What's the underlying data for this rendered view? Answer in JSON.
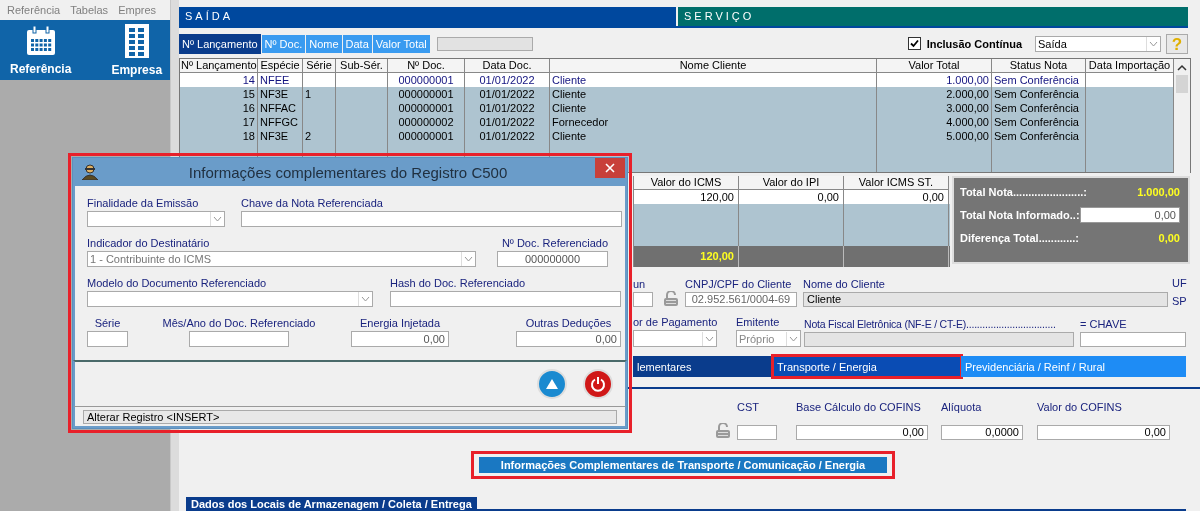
{
  "menu": [
    "Referência",
    "Tabelas",
    "Empres"
  ],
  "toolbar": [
    {
      "label": "Referência"
    },
    {
      "label": "Empresa"
    }
  ],
  "sections": [
    {
      "label": "SAÍDA",
      "color": "#00489e"
    },
    {
      "label": "SERVIÇO",
      "color": "#006e6b"
    }
  ],
  "sort_buttons": [
    {
      "label": "Nº Lançamento",
      "selected": true
    },
    {
      "label": "Nº Doc.",
      "selected": false
    },
    {
      "label": "Nome",
      "selected": false
    },
    {
      "label": "Data",
      "selected": false
    },
    {
      "label": "Valor Total",
      "selected": false
    }
  ],
  "continuous": {
    "label": "Inclusão Contínua",
    "checked": true
  },
  "type_select": {
    "value": "Saída"
  },
  "help": "?",
  "table": {
    "columns": [
      "Nº Lançamento",
      "Espécie",
      "Série",
      "Sub-Sér.",
      "Nº Doc.",
      "Data Doc.",
      "Nome Cliente",
      "Valor Total",
      "Status Nota",
      "Data Importação"
    ],
    "rows": [
      {
        "selected": true,
        "cells": [
          "14",
          "NFEE",
          "",
          "",
          "000000001",
          "01/01/2022",
          "Cliente",
          "1.000,00",
          "Sem Conferência",
          ""
        ]
      },
      {
        "selected": false,
        "cells": [
          "15",
          "NF3E",
          "1",
          "",
          "000000001",
          "01/01/2022",
          "Cliente",
          "2.000,00",
          "Sem Conferência",
          ""
        ]
      },
      {
        "selected": false,
        "cells": [
          "16",
          "NFFAC",
          "",
          "",
          "000000001",
          "01/01/2022",
          "Cliente",
          "3.000,00",
          "Sem Conferência",
          ""
        ]
      },
      {
        "selected": false,
        "cells": [
          "17",
          "NFFGC",
          "",
          "",
          "000000002",
          "01/01/2022",
          "Fornecedor",
          "4.000,00",
          "Sem Conferência",
          ""
        ]
      },
      {
        "selected": false,
        "cells": [
          "18",
          "NF3E",
          "2",
          "",
          "000000001",
          "01/01/2022",
          "Cliente",
          "5.000,00",
          "Sem Conferência",
          ""
        ]
      }
    ]
  },
  "items_table": {
    "columns": [
      "Valor do ICMS",
      "Valor do IPI",
      "Valor ICMS ST."
    ],
    "row": [
      "120,00",
      "0,00",
      "0,00"
    ],
    "total": "120,00"
  },
  "totals": [
    {
      "kind": "text",
      "label": "Total Nota.......................:",
      "value": "1.000,00"
    },
    {
      "kind": "input",
      "label": "Total Nota Informado..:",
      "value": "0,00"
    },
    {
      "kind": "text",
      "label": "Diferença Total............:",
      "value": "0,00"
    }
  ],
  "client": {
    "mun_label": "un",
    "cnpj_label": "CNPJ/CPF do Cliente",
    "cnpj": "02.952.561/0004-69",
    "name_label": "Nome do Cliente",
    "name": "Cliente",
    "uf_label": "UF",
    "uf": "SP"
  },
  "payment": {
    "label": "or de Pagamento"
  },
  "emitente": {
    "label": "Emitente",
    "value": "Próprio"
  },
  "nfe": {
    "label": "Nota Fiscal Eletrônica (NF-E / CT-E).................................",
    "key_label": "=  CHAVE"
  },
  "tabs": [
    {
      "label": "lementares",
      "selected": false,
      "highlighted": false
    },
    {
      "label": "Transporte / Energia",
      "selected": true,
      "highlighted": true
    },
    {
      "label": "Previdenciária / Reinf / Rural",
      "selected": false,
      "highlighted": false
    }
  ],
  "cofins": [
    {
      "label": "CST"
    },
    {
      "label": "Base Cálculo do COFINS",
      "value": "0,00"
    },
    {
      "label": "Alíquota",
      "value": "0,0000"
    },
    {
      "label": "Valor do COFINS",
      "value": "0,00"
    }
  ],
  "info_button": {
    "label": "Informações Complementares de Transporte / Comunicação / Energia",
    "highlighted": true
  },
  "section_header": "Dados dos Locais de Armazenagem / Coleta / Entrega",
  "dialog": {
    "title": "Informações complementares do Registro C500",
    "highlighted": true,
    "fields": [
      {
        "label": "Finalidade da Emissão",
        "kind": "select"
      },
      {
        "label": "Chave da Nota Referenciada",
        "kind": "input"
      },
      {
        "label": "Indicador do Destinatário",
        "kind": "select",
        "value": "1 - Contribuinte do ICMS"
      },
      {
        "label": "Nº Doc. Referenciado",
        "kind": "input",
        "value": "000000000"
      },
      {
        "label": "Modelo do Documento Referenciado",
        "kind": "select"
      },
      {
        "label": "Hash do Doc. Referenciado",
        "kind": "input"
      },
      {
        "label": "Série",
        "kind": "input"
      },
      {
        "label": "Mês/Ano do Doc. Referenciado",
        "kind": "input"
      },
      {
        "label": "Energia Injetada",
        "kind": "input",
        "value": "0,00"
      },
      {
        "label": "Outras Deduções",
        "kind": "input",
        "value": "0,00"
      }
    ],
    "status": "Alterar Registro  <INSERT>"
  }
}
